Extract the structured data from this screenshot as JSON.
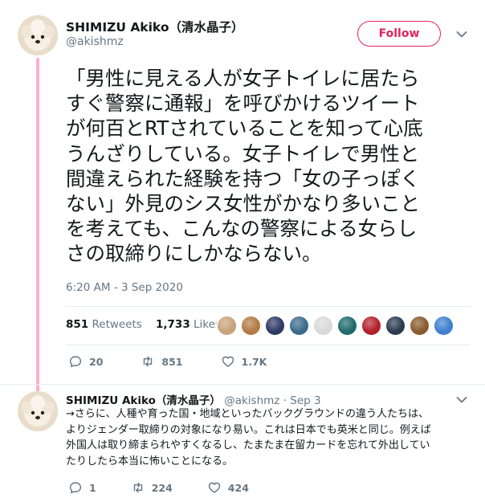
{
  "tweet": {
    "display_name": "SHIMIZU Akiko（清水晶子）",
    "handle": "@akishmz",
    "follow_label": "Follow",
    "text_lines": [
      "「男性に見える人が女子トイレに居たら",
      "すぐ警察に通報」を呼びかけるツイート",
      "が何百とRTされていることを知って心底",
      "うんざりしている。女子トイレで男性と",
      "間違えられた経験を持つ「女の子っぽく",
      "ない」外見のシス女性がかなり多いこと",
      "を考えても、こんなの警察による女らし",
      "さの取締りにしかならない。"
    ],
    "timestamp": "6:20 AM - 3 Sep 2020",
    "retweets_count": "851",
    "retweets_label": "Retweets",
    "likes_count": "1,733",
    "likes_label": "Likes",
    "liker_colors": [
      "#c9a27a",
      "#b37a44",
      "#2e3a66",
      "#3a6a8c",
      "#d9d9d9",
      "#1f6b6b",
      "#b3202a",
      "#2a3b4f",
      "#8a5a2e",
      "#3f7fd0"
    ],
    "actions": {
      "replies": "20",
      "retweets": "851",
      "likes": "1.7K"
    }
  },
  "reply": {
    "display_name": "SHIMIZU Akiko（清水晶子）",
    "handle": "@akishmz",
    "date": "· Sep 3",
    "text_lines": [
      "→さらに、人種や育った国・地域といったバックグラウンドの違う人たちは、",
      "よりジェンダー取締りの対象になり易い。これは日本でも英米と同じ。例えば",
      "外国人は取り締まられやすくなるし、たまたま在留カードを忘れて外出してい",
      "たりしたら本当に怖いことになる。"
    ],
    "actions": {
      "replies": "1",
      "retweets": "224",
      "likes": "424"
    }
  },
  "colors": {
    "accent": "#e0245e",
    "thread_line": "#ffadcf",
    "muted": "#657786",
    "text": "#14171a"
  },
  "icons": [
    "reply-icon",
    "retweet-icon",
    "like-icon",
    "chevron-down-icon"
  ]
}
